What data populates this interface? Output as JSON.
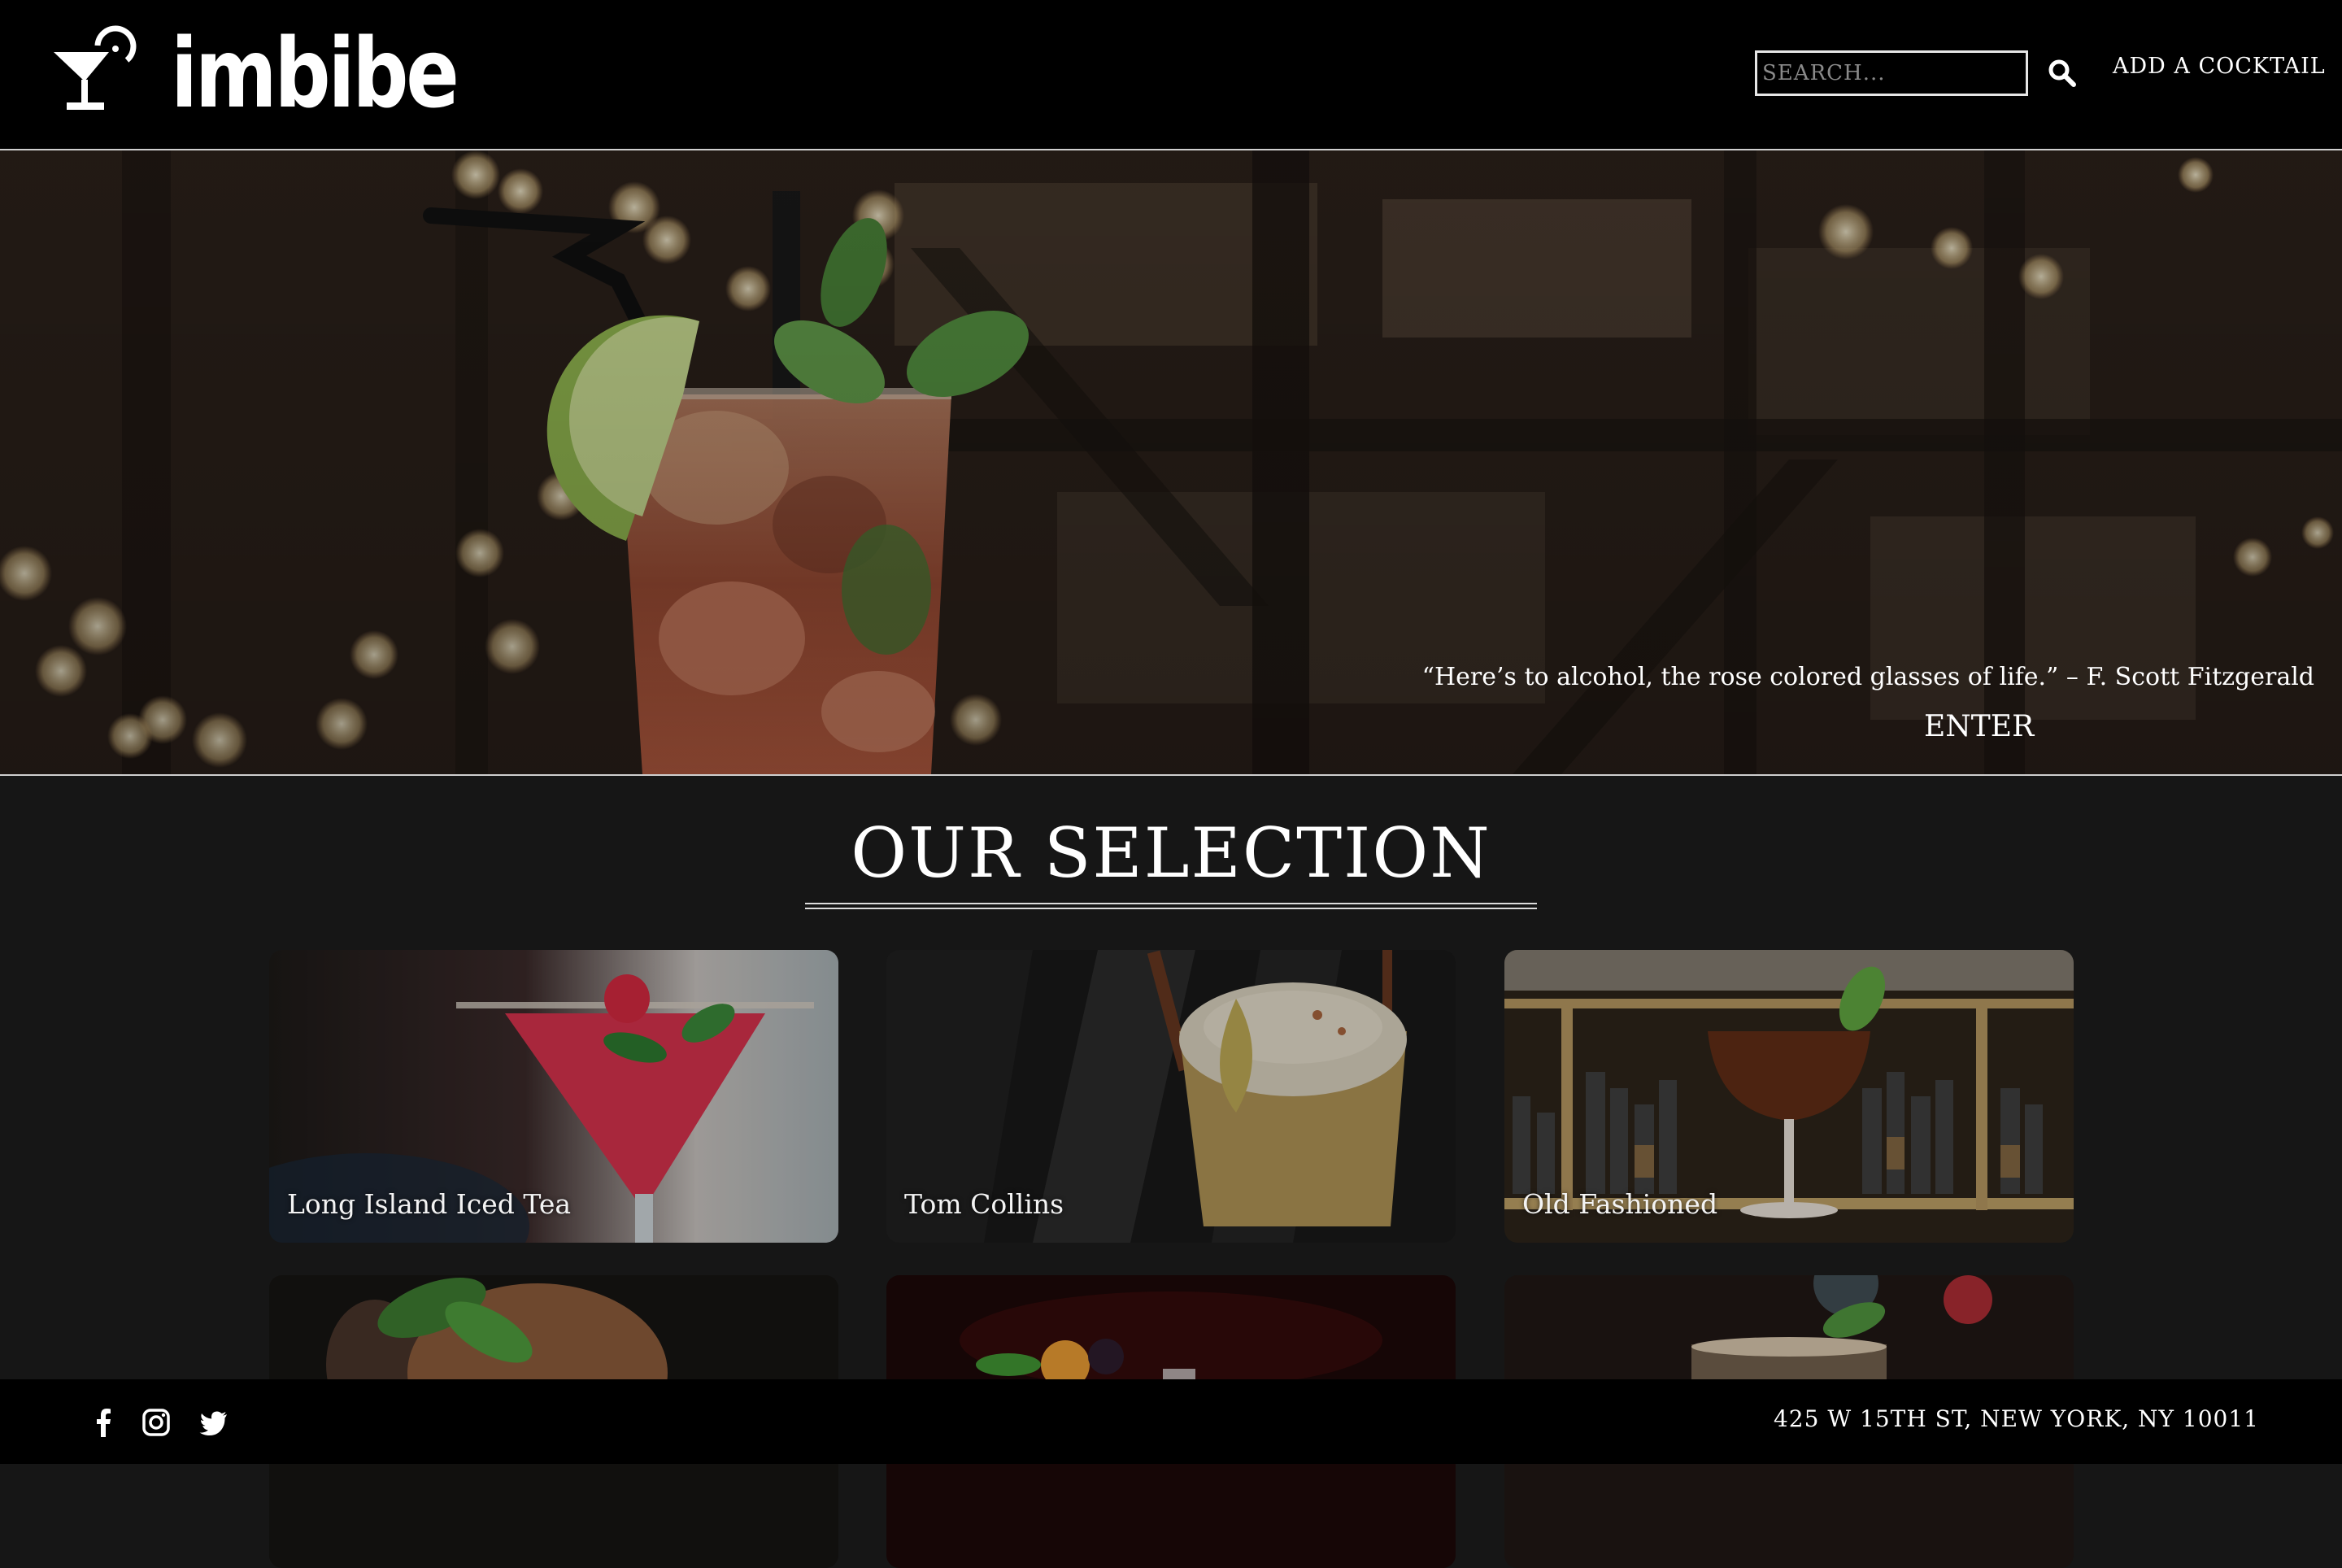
{
  "header": {
    "brand": "imbibe",
    "search_placeholder": "SEARCH...",
    "add_label": "ADD A COCKTAIL"
  },
  "hero": {
    "quote": "“Here’s to alcohol, the rose colored glasses of life.” – F. Scott Fitzgerald",
    "enter_label": "ENTER"
  },
  "selection": {
    "title": "OUR SELECTION",
    "cards": [
      {
        "label": "Long Island Iced Tea"
      },
      {
        "label": "Tom Collins"
      },
      {
        "label": "Old Fashioned"
      },
      {
        "label": ""
      },
      {
        "label": ""
      },
      {
        "label": ""
      }
    ]
  },
  "footer": {
    "address": "425 W 15TH ST, NEW YORK, NY 10011",
    "social": [
      "facebook-icon",
      "instagram-icon",
      "twitter-icon"
    ]
  }
}
